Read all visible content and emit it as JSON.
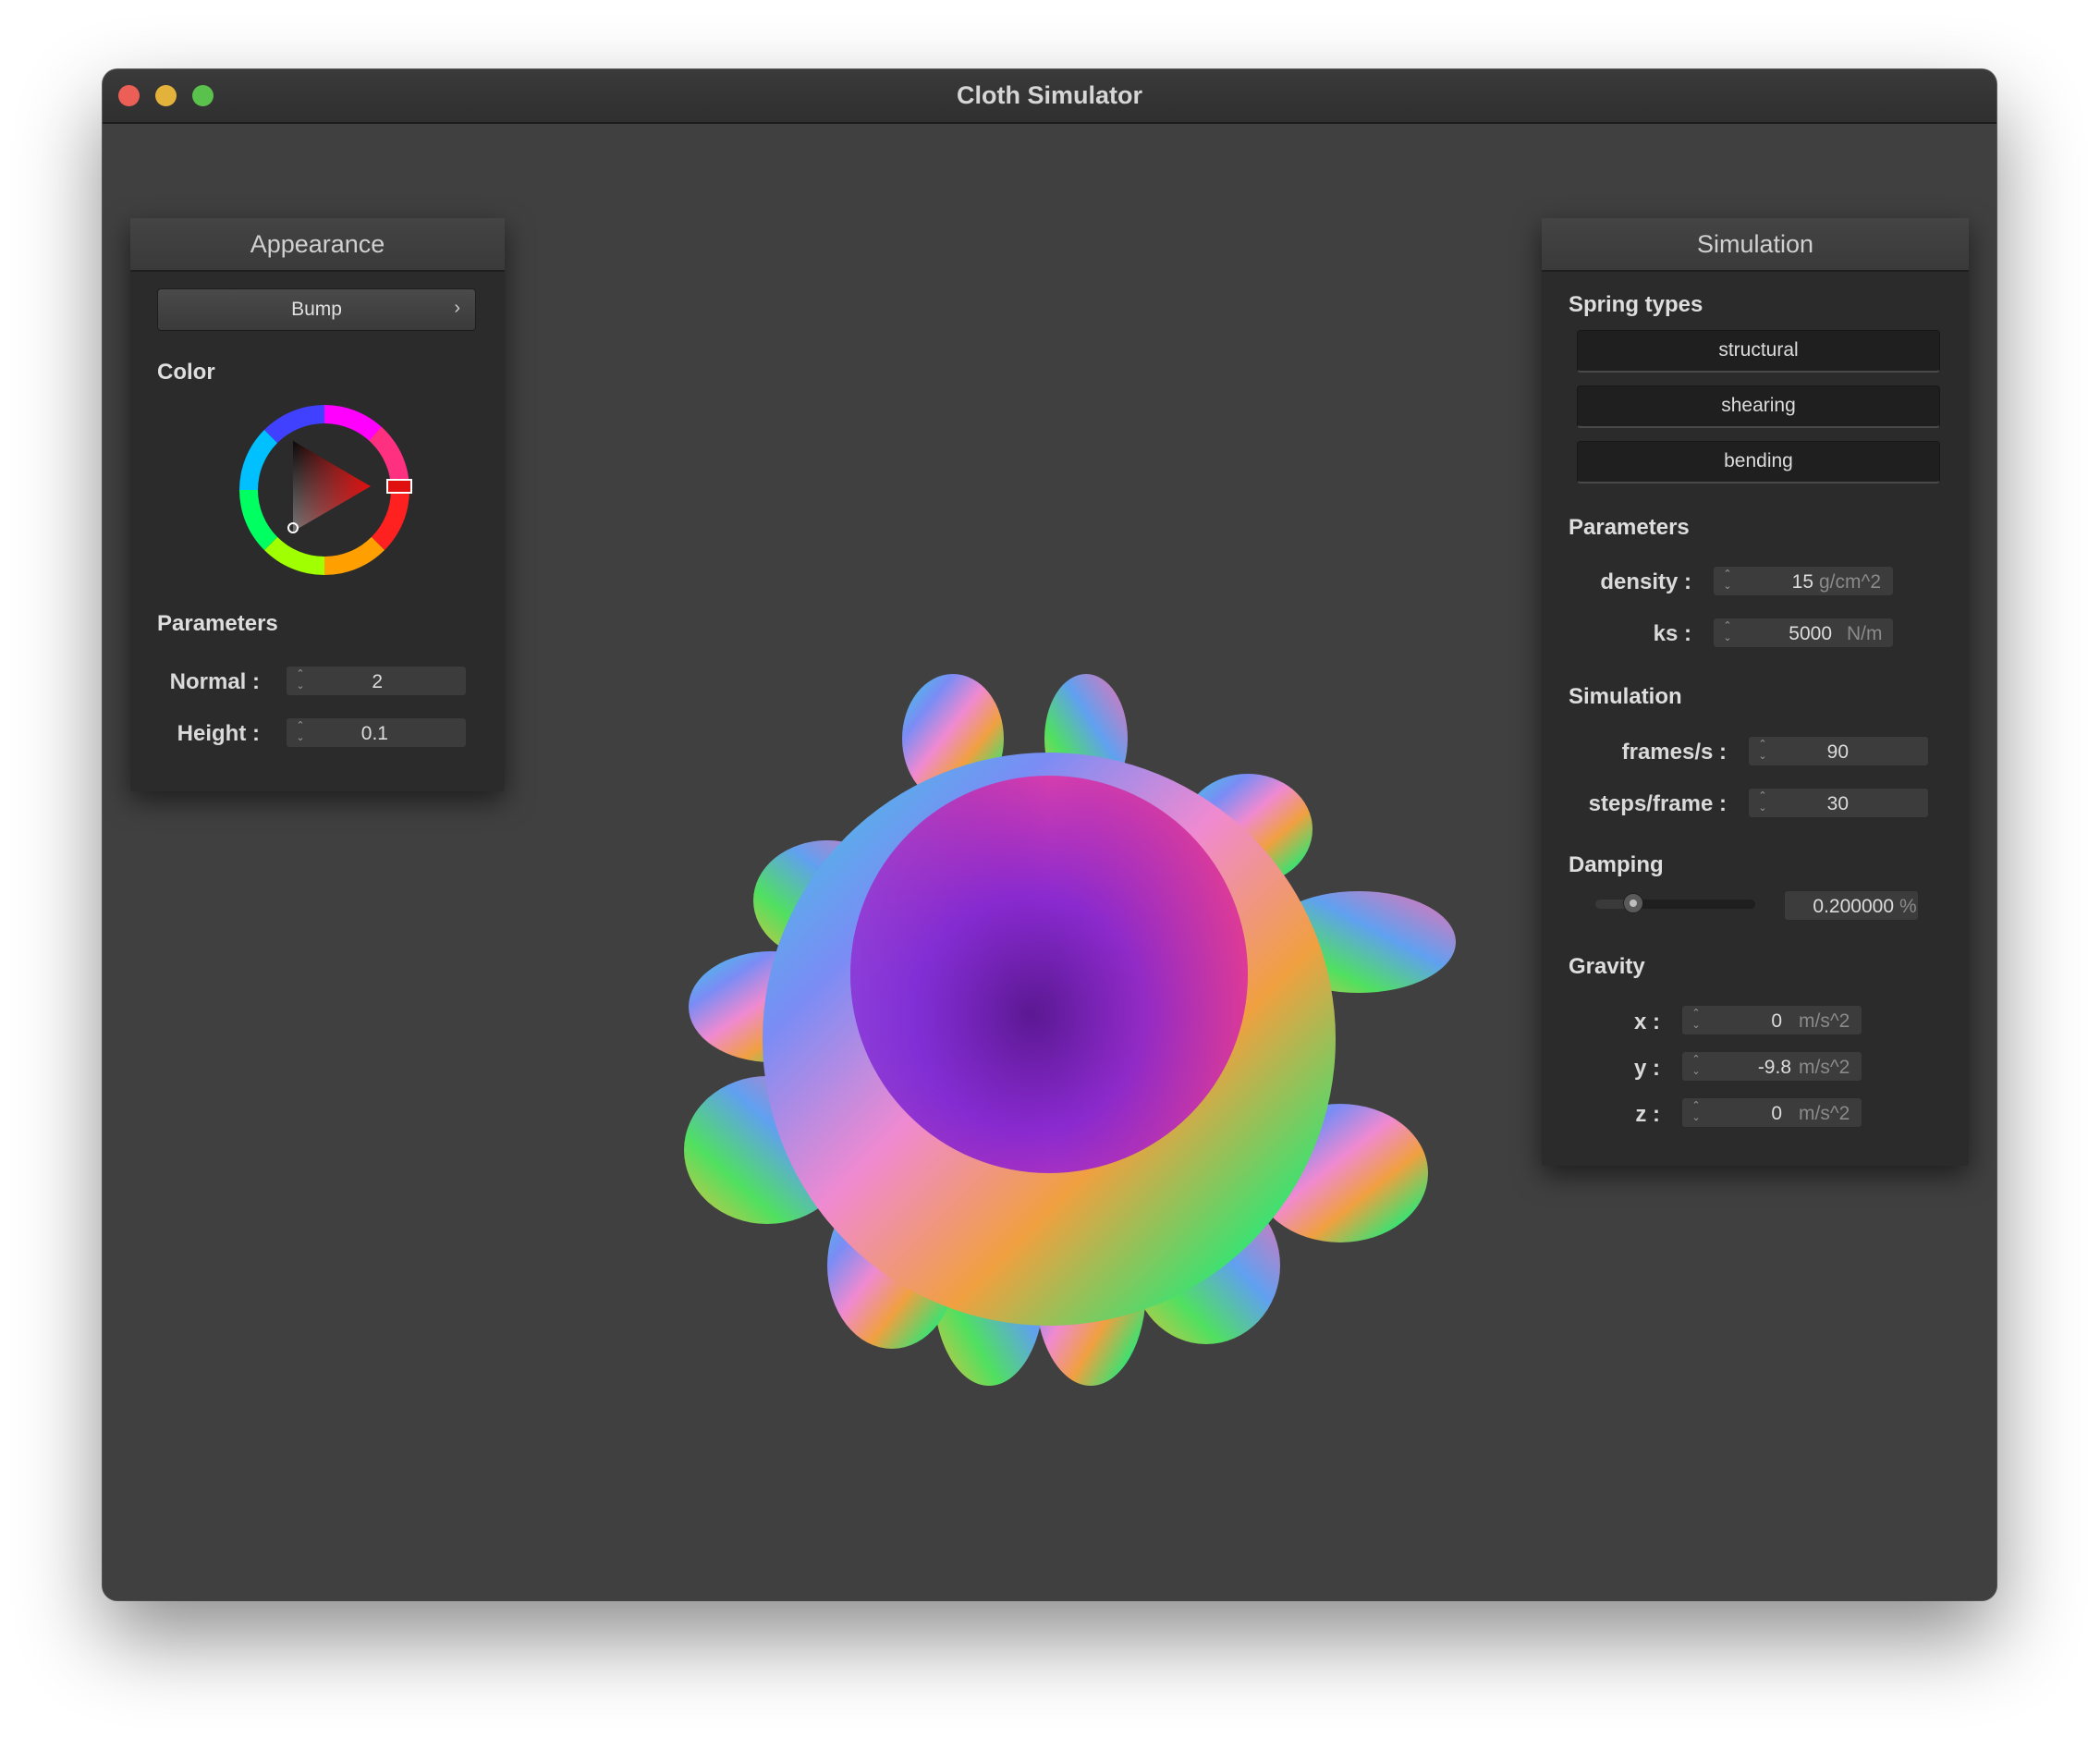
{
  "window": {
    "title": "Cloth Simulator"
  },
  "appearance": {
    "title": "Appearance",
    "shader_select": "Bump",
    "color_label": "Color",
    "selected_color": "#e02020",
    "parameters_label": "Parameters",
    "normal": {
      "label": "Normal :",
      "value": "2"
    },
    "height": {
      "label": "Height :",
      "value": "0.1"
    }
  },
  "simulation": {
    "title": "Simulation",
    "spring_types_label": "Spring types",
    "spring_buttons": [
      "structural",
      "shearing",
      "bending"
    ],
    "parameters_label": "Parameters",
    "density": {
      "label": "density :",
      "value": "15",
      "unit": "g/cm^2"
    },
    "ks": {
      "label": "ks :",
      "value": "5000",
      "unit": "N/m"
    },
    "simulation_label": "Simulation",
    "frames_per_s": {
      "label": "frames/s :",
      "value": "90"
    },
    "steps_per_frame": {
      "label": "steps/frame :",
      "value": "30"
    },
    "damping_label": "Damping",
    "damping": {
      "value": "0.200000",
      "unit": "%",
      "slider_fraction": 0.2
    },
    "gravity_label": "Gravity",
    "gravity": {
      "x": {
        "label": "x :",
        "value": "0",
        "unit": "m/s^2"
      },
      "y": {
        "label": "y :",
        "value": "-9.8",
        "unit": "m/s^2"
      },
      "z": {
        "label": "z :",
        "value": "0",
        "unit": "m/s^2"
      }
    }
  }
}
